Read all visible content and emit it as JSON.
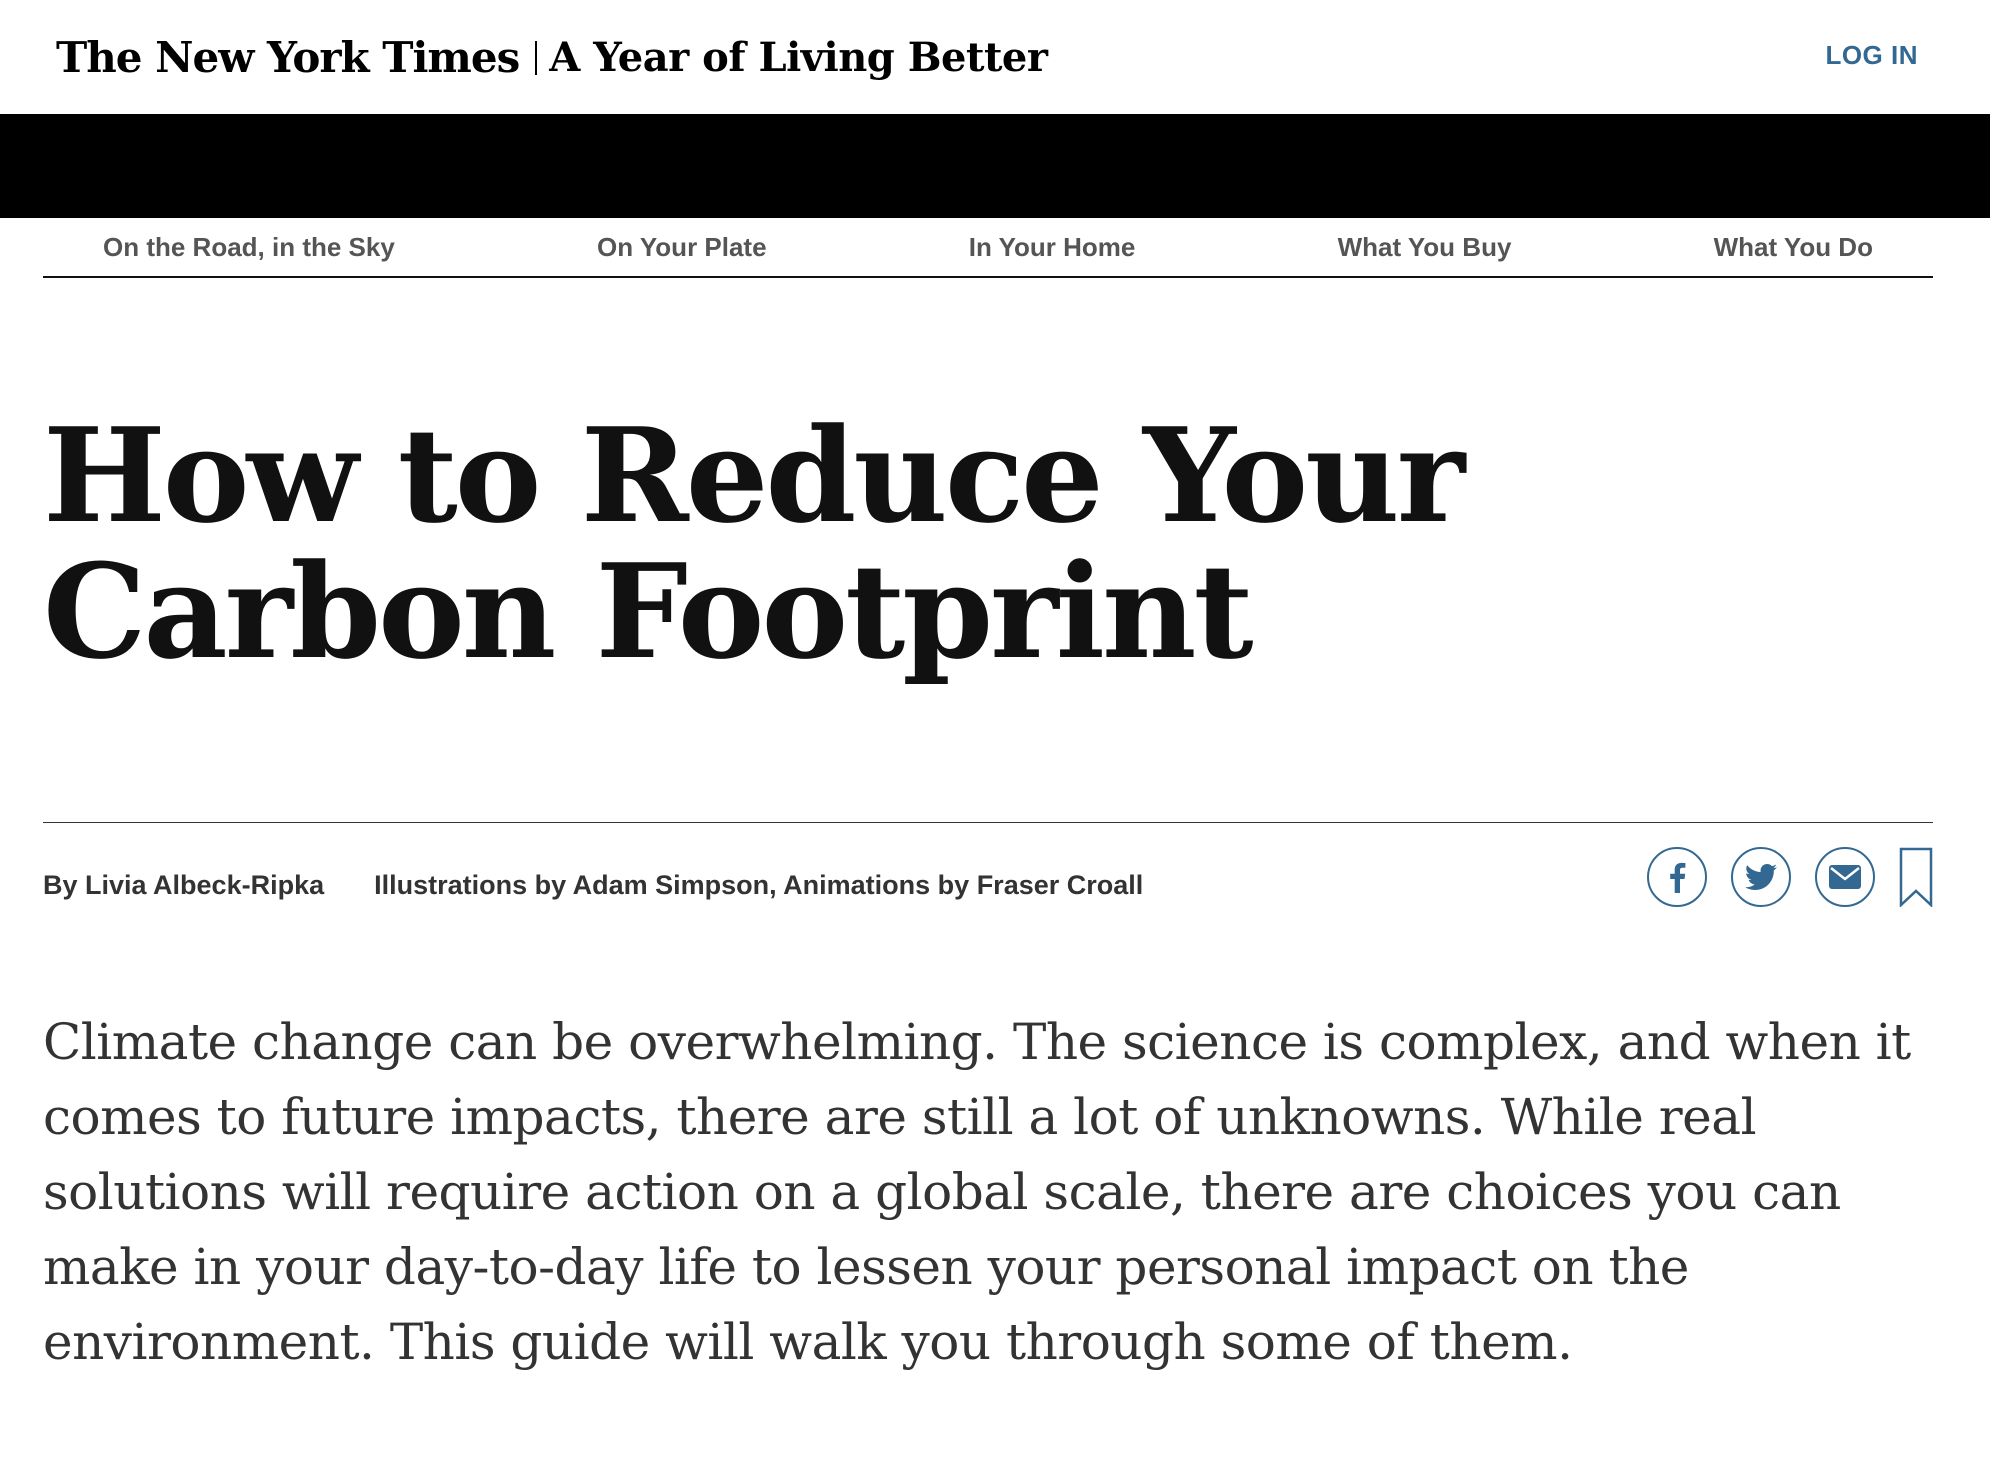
{
  "header": {
    "logo_text": "The New York Times",
    "section_title": "A Year of Living Better",
    "login_label": "LOG IN"
  },
  "subnav": {
    "items": [
      {
        "label": "On the Road, in the Sky"
      },
      {
        "label": "On Your Plate"
      },
      {
        "label": "In Your Home"
      },
      {
        "label": "What You Buy"
      },
      {
        "label": "What You Do"
      }
    ]
  },
  "article": {
    "headline": "How to Reduce Your Carbon Footprint",
    "byline": "By Livia Albeck-Ripka",
    "credits": "Illustrations by Adam Simpson, Animations by Fraser Croall",
    "intro": "Climate change can be overwhelming. The science is complex, and when it comes to future impacts, there are still a lot of unknowns. While real solutions will require action on a global scale, there are choices you can make in your day-to-day life to lessen your personal impact on the environment. This guide will walk you through some of them."
  },
  "share": {
    "icons": [
      "facebook-icon",
      "twitter-icon",
      "email-icon",
      "bookmark-icon"
    ]
  },
  "colors": {
    "accent": "#326891",
    "text": "#111111",
    "muted": "#555555",
    "band": "#000000"
  }
}
